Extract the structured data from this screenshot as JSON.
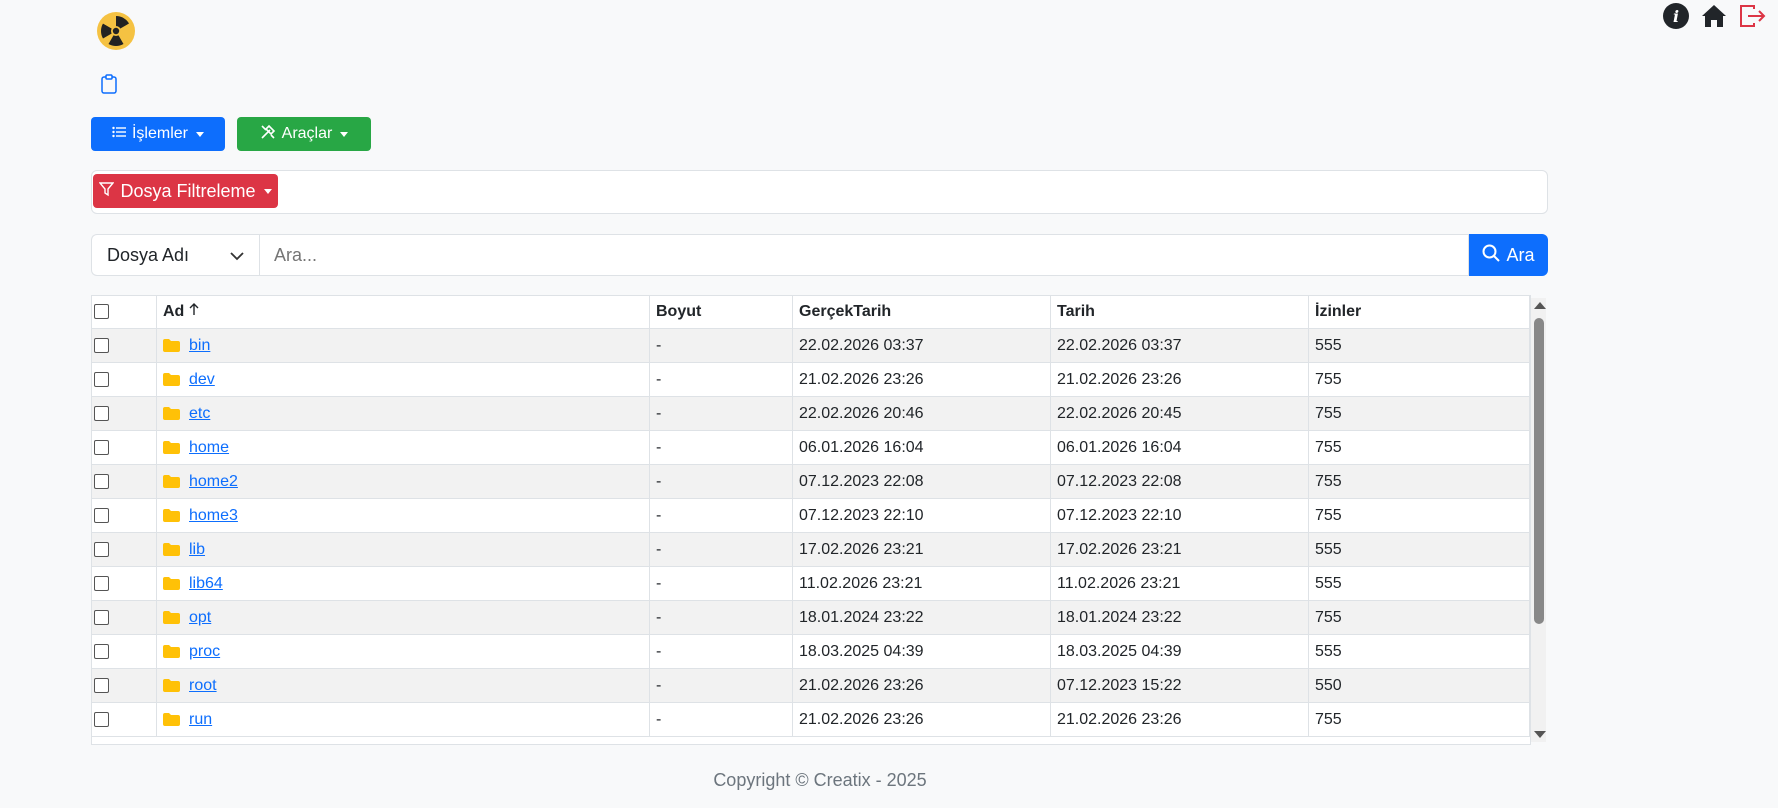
{
  "header": {
    "logo_icon": "radiation-icon",
    "icons": [
      "info-icon",
      "home-icon",
      "logout-icon"
    ],
    "clipboard_icon": "clipboard-icon"
  },
  "toolbar": {
    "operations_label": "İşlemler",
    "tools_label": "Araçlar",
    "filter_label": "Dosya Filtreleme"
  },
  "search": {
    "select_value": "Dosya Adı",
    "placeholder": "Ara...",
    "button_label": "Ara"
  },
  "table": {
    "columns": {
      "name": "Ad",
      "size": "Boyut",
      "real_date": "GerçekTarih",
      "date": "Tarih",
      "perms": "İzinler"
    },
    "rows": [
      {
        "name": "bin",
        "size": "-",
        "real_date": "22.02.2026 03:37",
        "date": "22.02.2026 03:37",
        "perms": "555"
      },
      {
        "name": "dev",
        "size": "-",
        "real_date": "21.02.2026 23:26",
        "date": "21.02.2026 23:26",
        "perms": "755"
      },
      {
        "name": "etc",
        "size": "-",
        "real_date": "22.02.2026 20:46",
        "date": "22.02.2026 20:45",
        "perms": "755"
      },
      {
        "name": "home",
        "size": "-",
        "real_date": "06.01.2026 16:04",
        "date": "06.01.2026 16:04",
        "perms": "755"
      },
      {
        "name": "home2",
        "size": "-",
        "real_date": "07.12.2023 22:08",
        "date": "07.12.2023 22:08",
        "perms": "755"
      },
      {
        "name": "home3",
        "size": "-",
        "real_date": "07.12.2023 22:10",
        "date": "07.12.2023 22:10",
        "perms": "755"
      },
      {
        "name": "lib",
        "size": "-",
        "real_date": "17.02.2026 23:21",
        "date": "17.02.2026 23:21",
        "perms": "555"
      },
      {
        "name": "lib64",
        "size": "-",
        "real_date": "11.02.2026 23:21",
        "date": "11.02.2026 23:21",
        "perms": "555"
      },
      {
        "name": "opt",
        "size": "-",
        "real_date": "18.01.2024 23:22",
        "date": "18.01.2024 23:22",
        "perms": "755"
      },
      {
        "name": "proc",
        "size": "-",
        "real_date": "18.03.2025 04:39",
        "date": "18.03.2025 04:39",
        "perms": "555"
      },
      {
        "name": "root",
        "size": "-",
        "real_date": "21.02.2026 23:26",
        "date": "07.12.2023 15:22",
        "perms": "550"
      },
      {
        "name": "run",
        "size": "-",
        "real_date": "21.02.2026 23:26",
        "date": "21.02.2026 23:26",
        "perms": "755"
      }
    ]
  },
  "footer": {
    "copyright": "Copyright © Creatix - 2025"
  }
}
